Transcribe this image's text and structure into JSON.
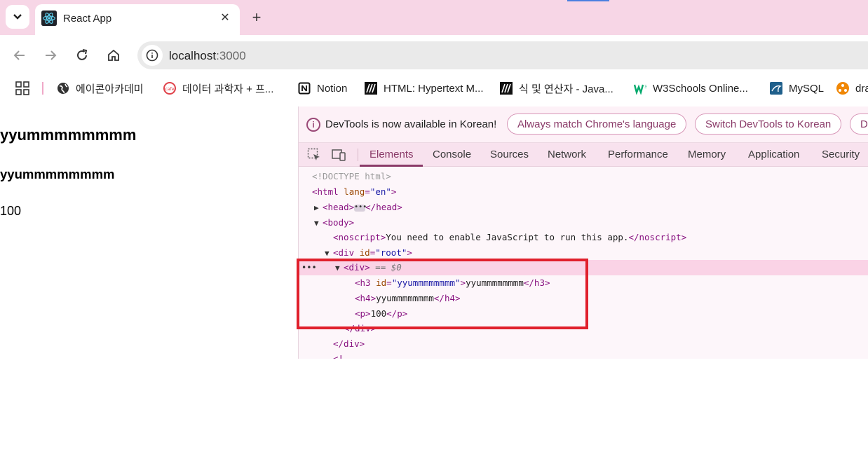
{
  "browser": {
    "tab": {
      "title": "React App"
    },
    "toolbar": {
      "url_host": "localhost",
      "url_port": ":3000"
    },
    "bookmarks": [
      {
        "label": "에이콘아카데미",
        "icon": "globe-icon"
      },
      {
        "label": "데이터 과학자 + 프...",
        "icon": "cafe-icon"
      },
      {
        "label": "Notion",
        "icon": "notion-icon"
      },
      {
        "label": "HTML: Hypertext M...",
        "icon": "mdn-icon"
      },
      {
        "label": "식 및 연산자 - Java...",
        "icon": "mdn-icon"
      },
      {
        "label": "W3Schools Online...",
        "icon": "w3schools-icon"
      },
      {
        "label": "MySQL",
        "icon": "mysql-icon"
      },
      {
        "label": "dra",
        "icon": "drawio-icon"
      }
    ]
  },
  "page": {
    "h3": "yyummmmmmmm",
    "h4": "yyummmmmmmm",
    "p": "100"
  },
  "devtools": {
    "infobar": {
      "message": "DevTools is now available in Korean!",
      "btn_match": "Always match Chrome's language",
      "btn_switch": "Switch DevTools to Korean",
      "btn_dont": "D"
    },
    "tabs": [
      "Elements",
      "Console",
      "Sources",
      "Network",
      "Performance",
      "Memory",
      "Application",
      "Security"
    ],
    "tree": {
      "doctype": "<!DOCTYPE html>",
      "html_open": "<html",
      "html_attr": "lang",
      "html_val": "\"en\"",
      "head_open": "<head>",
      "head_close": "</head>",
      "body_open": "<body>",
      "noscript_open": "<noscript>",
      "noscript_text": "You need to enable JavaScript to run this app.",
      "noscript_close": "</noscript>",
      "div_root_open": "<div",
      "div_root_attr": "id",
      "div_root_val": "\"root\"",
      "div_open": "<div>",
      "div_eq": "== $0",
      "h3_open": "<h3",
      "h3_attr": "id",
      "h3_val": "\"yyummmmmmmm\"",
      "h3_text": "yyummmmmmmm",
      "h3_close": "</h3>",
      "h4_open": "<h4>",
      "h4_text": "yyummmmmmmm",
      "h4_close": "</h4>",
      "p_open": "<p>",
      "p_text": "100",
      "p_close": "</p>",
      "div_close": "</div>",
      "div_root_close": "</div>",
      "comment_start": "<!--"
    },
    "colors": {
      "highlight_box": "#e0202c",
      "accent": "#8a3a68"
    }
  }
}
